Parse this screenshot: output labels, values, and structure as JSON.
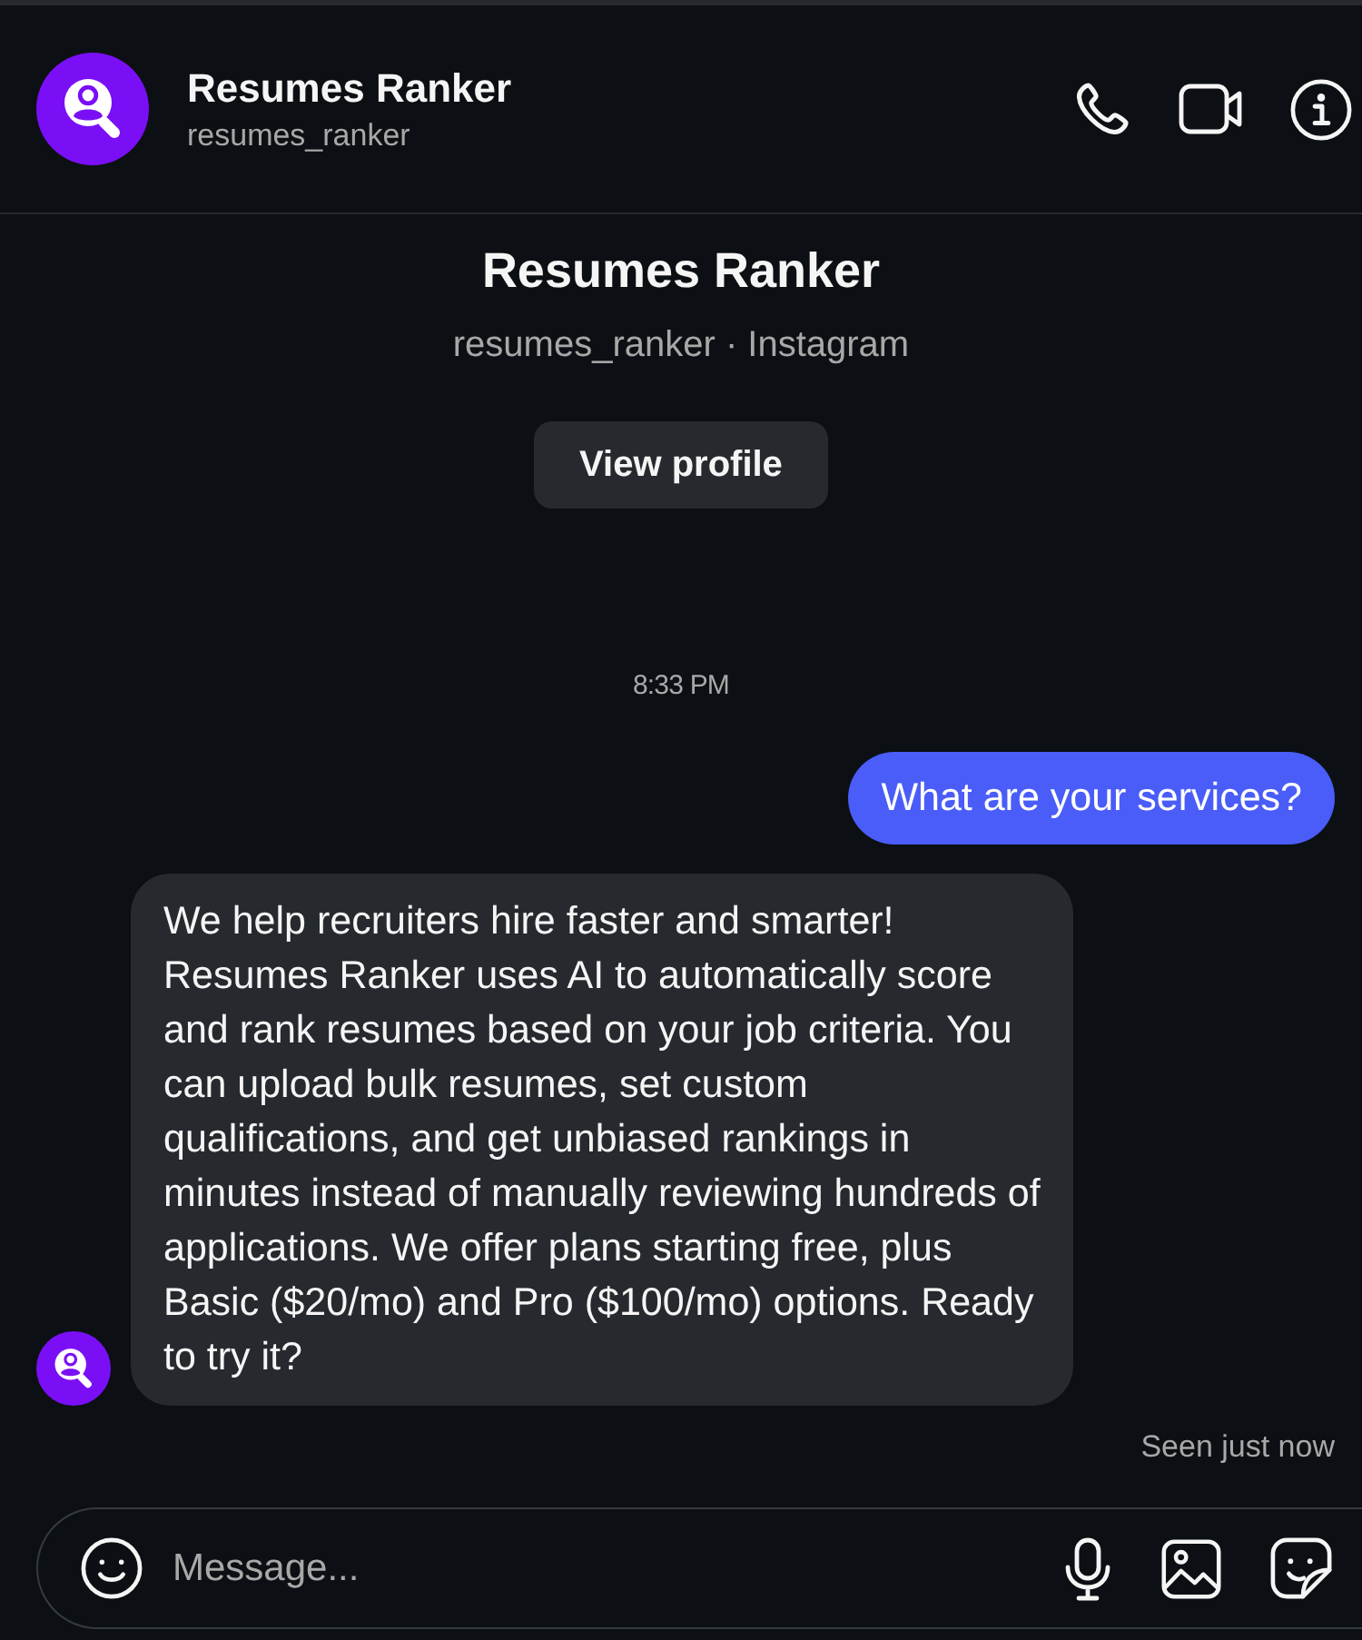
{
  "header": {
    "name": "Resumes Ranker",
    "username": "resumes_ranker"
  },
  "profile": {
    "name": "Resumes Ranker",
    "subtitle": "resumes_ranker · Instagram",
    "button": "View profile"
  },
  "messages": [
    {
      "kind": "timestamp",
      "text": "8:33 PM"
    },
    {
      "kind": "outgoing",
      "text": "What are your services?"
    },
    {
      "kind": "incoming",
      "text": "We help recruiters hire faster and smarter! Resumes Ranker uses AI to automatically score and rank resumes based on your job criteria. You can upload bulk resumes, set custom qualifications, and get unbiased rankings in minutes instead of manually reviewing hundreds of applications. We offer plans starting free, plus Basic ($20/mo) and Pro ($100/mo) options. Ready to try it?"
    },
    {
      "kind": "status",
      "text": "Seen just now"
    }
  ],
  "composer": {
    "placeholder": "Message..."
  }
}
